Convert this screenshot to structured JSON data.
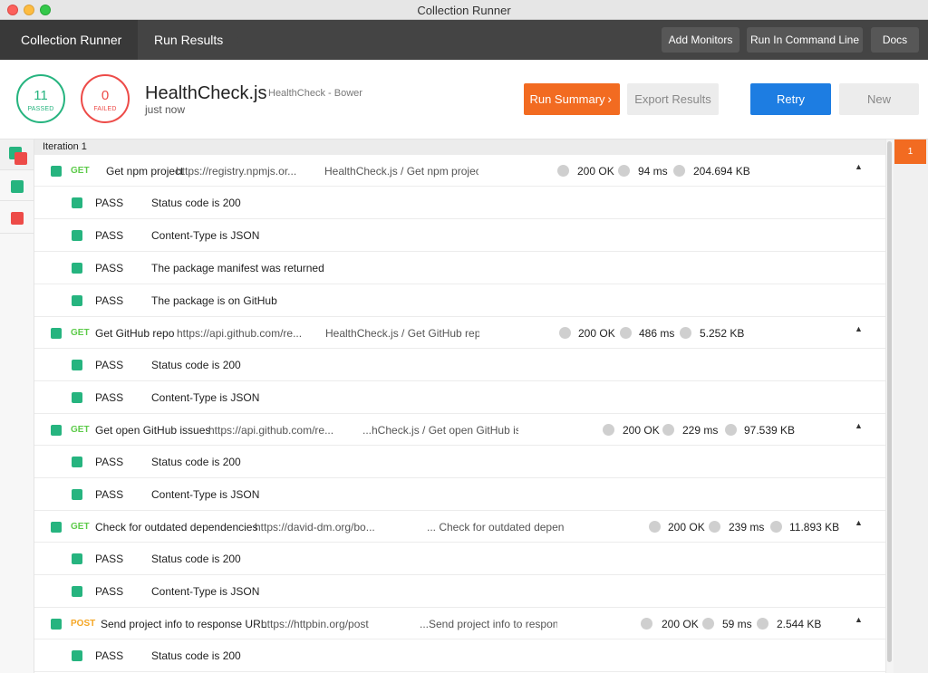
{
  "window": {
    "title": "Collection Runner"
  },
  "nav": {
    "breadcrumb": [
      "Collection Runner",
      "Run Results"
    ],
    "buttons": {
      "add_monitors": "Add Monitors",
      "run_cli": "Run In Command Line",
      "docs": "Docs"
    }
  },
  "summary": {
    "passed_count": "11",
    "passed_label": "PASSED",
    "failed_count": "0",
    "failed_label": "FAILED",
    "collection_name": "HealthCheck.js",
    "environment": "HealthCheck - Bower",
    "time": "just now",
    "run_summary_label": "Run Summary",
    "export_label": "Export Results",
    "retry_label": "Retry",
    "new_label": "New"
  },
  "colors": {
    "accent": "#f26b21",
    "pass": "#26b47f",
    "fail": "#ed4b48",
    "primary": "#1d7de2"
  },
  "results": {
    "iteration_label": "Iteration 1",
    "iteration_badge": "1",
    "requests": [
      {
        "method": "GET",
        "name": "Get npm project",
        "url": "https://registry.npmjs.or...",
        "path": "HealthCheck.js / Get npm project",
        "status": "200 OK",
        "time": "94 ms",
        "size": "204.694 KB",
        "tests": [
          {
            "result": "PASS",
            "name": "Status code is 200"
          },
          {
            "result": "PASS",
            "name": "Content-Type is JSON"
          },
          {
            "result": "PASS",
            "name": "The package manifest was returned"
          },
          {
            "result": "PASS",
            "name": "The package is on GitHub"
          }
        ]
      },
      {
        "method": "GET",
        "name": "Get GitHub repo",
        "url": "https://api.github.com/re...",
        "path": "HealthCheck.js / Get GitHub repo",
        "status": "200 OK",
        "time": "486 ms",
        "size": "5.252 KB",
        "tests": [
          {
            "result": "PASS",
            "name": "Status code is 200"
          },
          {
            "result": "PASS",
            "name": "Content-Type is JSON"
          }
        ]
      },
      {
        "method": "GET",
        "name": "Get open GitHub issues",
        "url": "https://api.github.com/re...",
        "path": "...hCheck.js / Get open GitHub issu",
        "status": "200 OK",
        "time": "229 ms",
        "size": "97.539 KB",
        "tests": [
          {
            "result": "PASS",
            "name": "Status code is 200"
          },
          {
            "result": "PASS",
            "name": "Content-Type is JSON"
          }
        ]
      },
      {
        "method": "GET",
        "name": "Check for outdated dependencies",
        "url": "https://david-dm.org/bo...",
        "path": "... Check for outdated depende",
        "status": "200 OK",
        "time": "239 ms",
        "size": "11.893 KB",
        "tests": [
          {
            "result": "PASS",
            "name": "Status code is 200"
          },
          {
            "result": "PASS",
            "name": "Content-Type is JSON"
          }
        ]
      },
      {
        "method": "POST",
        "name": "Send project info to response URL",
        "url": "https://httpbin.org/post",
        "path": "...Send project info to respons",
        "status": "200 OK",
        "time": "59 ms",
        "size": "2.544 KB",
        "tests": [
          {
            "result": "PASS",
            "name": "Status code is 200"
          }
        ]
      }
    ]
  }
}
